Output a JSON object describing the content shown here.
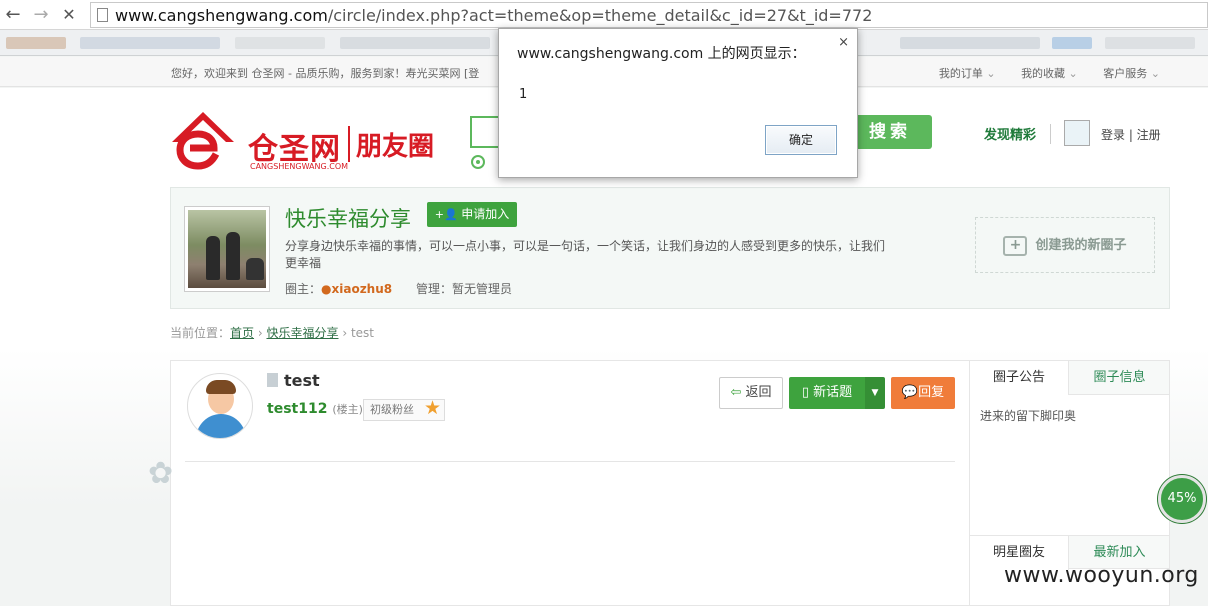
{
  "browser": {
    "back": "←",
    "forward": "→",
    "stop": "✕",
    "url_host": "www.cangshengwang.com",
    "url_rest": "/circle/index.php?act=theme&op=theme_detail&c_id=27&t_id=772"
  },
  "topbar": {
    "welcome": "您好，欢迎来到 仓圣网 - 品质乐购，服务到家！寿光买菜网 [登",
    "links": [
      "我的订单",
      "我的收藏",
      "客户服务"
    ]
  },
  "header": {
    "logo_cn": "仓圣网",
    "logo_en": "CANGSHENGWANG.COM",
    "logo_circle": "朋友圈",
    "search_label": "搜索",
    "discover": "发现精彩",
    "login": "登录 | 注册"
  },
  "circle": {
    "name": "快乐幸福分享",
    "join_label": "申请加入",
    "description": "分享身边快乐幸福的事情，可以一点小事，可以是一句话，一个笑话，让我们身边的人感受到更多的快乐，让我们更幸福",
    "owner_label": "圈主：",
    "owner": "xiaozhu8",
    "admin_label": "管理：",
    "admin": "暂无管理员",
    "create_label": "创建我的新圈子"
  },
  "breadcrumb": {
    "prefix": "当前位置：",
    "home": "首页",
    "circle": "快乐幸福分享",
    "current": "test"
  },
  "post": {
    "title": "test",
    "author": "test112",
    "author_role": "(楼主)",
    "rank": "初级粉丝",
    "back_label": "返回",
    "new_topic_label": "新话题",
    "reply_label": "回复"
  },
  "side": {
    "tabs_top": [
      "圈子公告",
      "圈子信息"
    ],
    "notice": "进来的留下脚印奥",
    "tabs_bottom": [
      "明星圈友",
      "最新加入"
    ]
  },
  "overlay": {
    "progress": "45%",
    "watermark": "www.wooyun.org"
  },
  "dialog": {
    "title": "www.cangshengwang.com 上的网页显示：",
    "message": "1",
    "ok_label": "确定",
    "close": "×"
  },
  "colors": {
    "brand_red": "#d71b24",
    "accent_green": "#3ea33e",
    "reply_orange": "#f07c3a"
  }
}
